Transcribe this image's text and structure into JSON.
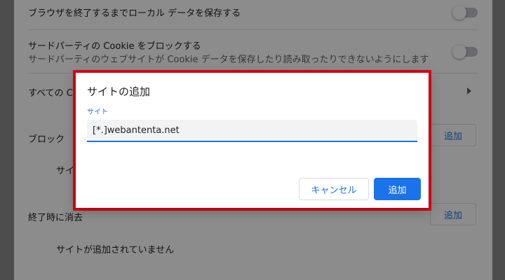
{
  "settings": {
    "rows": {
      "keep_local_data": "ブラウザを終了するまでローカル データを保存する",
      "block_third_party": "サードパーティの Cookie をブロックする",
      "block_third_party_desc": "サードパーティのウェブサイトが Cookie データを保存したり読み取ったりできないようにします",
      "all_cookies_partial": "すべての C",
      "block_section_partial": "ブロック",
      "block_empty_partial": "サイト",
      "clear_on_exit_partial": "終了時に消去",
      "clear_on_exit_empty": "サイトが追加されていません"
    },
    "add_button_label": "追加"
  },
  "dialog": {
    "title": "サイトの追加",
    "field_label": "サイト",
    "field_value": "[*.]webantenta.net",
    "cancel_label": "キャンセル",
    "add_label": "追加",
    "highlight_color": "#e60012",
    "accent_color": "#1a73e8"
  }
}
